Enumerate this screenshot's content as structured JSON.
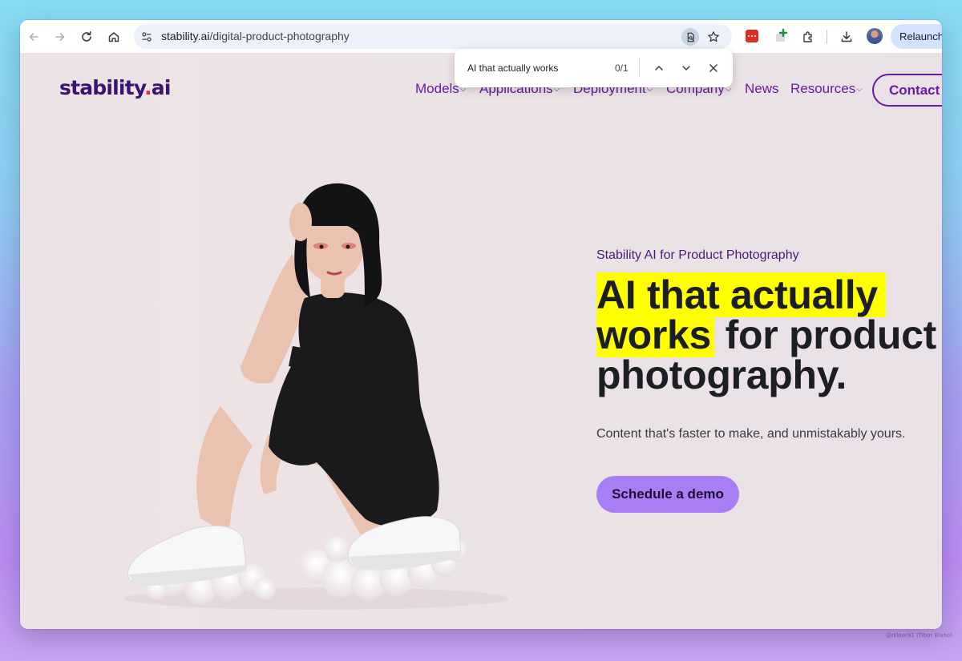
{
  "browser": {
    "url_host": "stability.ai",
    "url_path": "/digital-product-photography",
    "relaunch_label": "Relaunch",
    "icons": {
      "back": "arrow-left-icon",
      "forward": "arrow-right-icon",
      "reload": "reload-icon",
      "home": "home-icon",
      "site_info": "tune-icon",
      "find_in_page": "find-in-page-icon",
      "bookmark": "star-icon",
      "extension_red": "extension-icon",
      "extension_green": "extension-plus-icon",
      "extensions": "puzzle-icon",
      "download": "download-icon"
    }
  },
  "find_bar": {
    "query": "AI that actually works",
    "count": "0/1"
  },
  "site": {
    "logo_main": "stability",
    "logo_dot": ".",
    "logo_suffix": "ai",
    "nav": [
      {
        "label": "Models"
      },
      {
        "label": "Applications"
      },
      {
        "label": "Deployment"
      },
      {
        "label": "Company"
      },
      {
        "label": "News"
      },
      {
        "label": "Resources"
      }
    ],
    "contact_label": "Contact"
  },
  "hero": {
    "eyebrow": "Stability AI for Product Photography",
    "headline_line1": "AI that actually",
    "headline_line2_mark": "works",
    "headline_line2_rest": " for product",
    "headline_line3": "photography.",
    "subtext": "Content that's faster to make, and unmistakably yours.",
    "cta_label": "Schedule a demo"
  },
  "credit": "@dlloor91 (Tibor Blaho)",
  "colors": {
    "brand_purple": "#6a1aa3",
    "logo_purple": "#3a1470",
    "logo_dot": "#e0245e",
    "highlight": "#ffff00",
    "cta_bg": "#a87ef5",
    "headline": "#1d1d24"
  }
}
